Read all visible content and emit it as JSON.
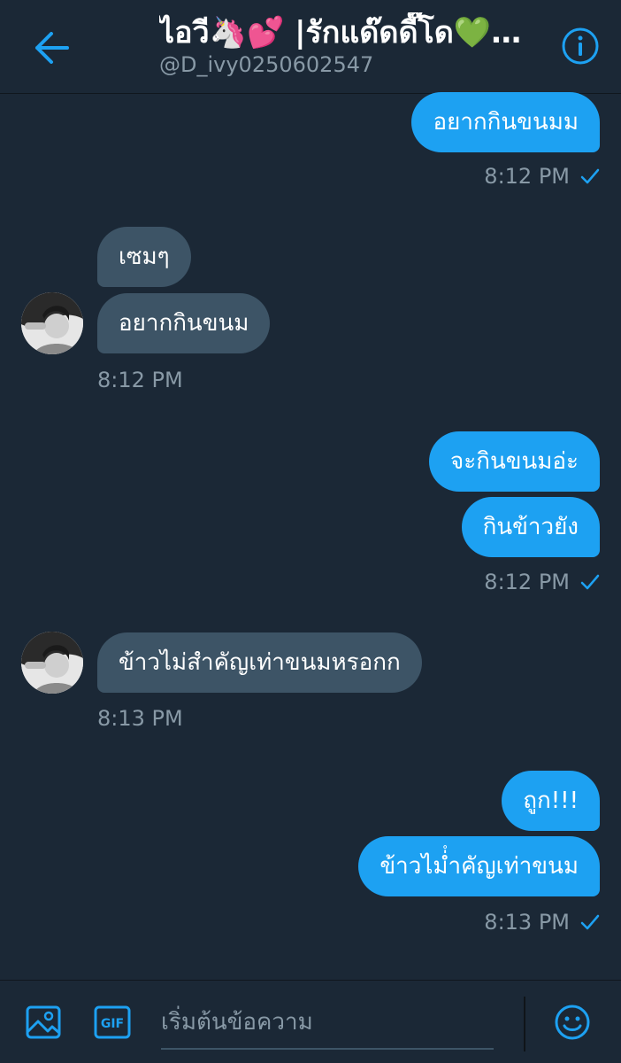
{
  "header": {
    "title": "ไอวี🦄💕 |รักแด๊ดดี๊โด💚…",
    "handle": "@D_ivy0250602547"
  },
  "messages": {
    "m1": "อยากกินขนมม",
    "t1": "8:12 PM",
    "m2": "เซมๆ",
    "m3": "อยากกินขนม",
    "t2": "8:12 PM",
    "m4": "จะกินขนมอ่ะ",
    "m5": "กินข้าวยัง",
    "t3": "8:12 PM",
    "m6": "ข้าวไม่สำคัญเท่าขนมหรอกก",
    "t4": "8:13 PM",
    "m7": "ถูก!!!",
    "m8": "ข้าวไม่ํำคัญเท่าขนม",
    "t5": "8:13 PM"
  },
  "composer": {
    "placeholder": "เริ่มต้นข้อความ",
    "gif_label": "GIF"
  },
  "icons": {
    "back": "arrow-left-icon",
    "info": "info-icon",
    "media": "image-icon",
    "gif": "gif-icon",
    "emoji": "emoji-icon",
    "read": "checkmark-icon"
  },
  "colors": {
    "background": "#1b2836",
    "accent": "#1da1f2",
    "incoming_bubble": "#3d5466",
    "muted_text": "#8899a6"
  }
}
